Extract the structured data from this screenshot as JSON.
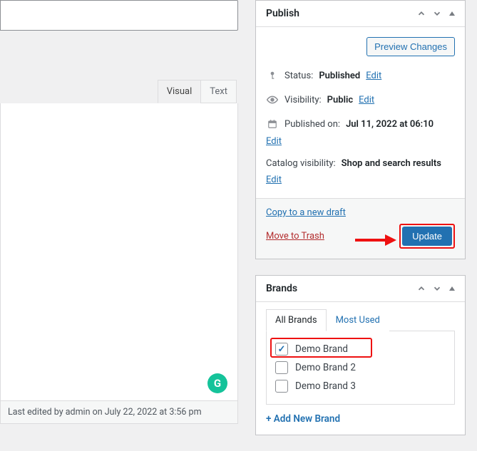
{
  "editor": {
    "tabs": {
      "visual": "Visual",
      "text": "Text"
    },
    "status_bar": "Last edited by admin on July 22, 2022 at 3:56 pm",
    "grammarly_glyph": "G"
  },
  "publish": {
    "title": "Publish",
    "preview_button": "Preview Changes",
    "status_label": "Status:",
    "status_value": "Published",
    "status_edit": "Edit",
    "visibility_label": "Visibility:",
    "visibility_value": "Public",
    "visibility_edit": "Edit",
    "published_label": "Published on:",
    "published_value": "Jul 11, 2022 at 06:10",
    "published_edit": "Edit",
    "catalog_label": "Catalog visibility:",
    "catalog_value": "Shop and search results",
    "catalog_edit": "Edit",
    "copy_link": "Copy to a new draft",
    "trash_link": "Move to Trash",
    "update_button": "Update"
  },
  "brands": {
    "title": "Brands",
    "tab_all": "All Brands",
    "tab_most": "Most Used",
    "items": [
      {
        "label": "Demo Brand",
        "checked": true,
        "highlight": true
      },
      {
        "label": "Demo Brand 2",
        "checked": false,
        "highlight": false
      },
      {
        "label": "Demo Brand 3",
        "checked": false,
        "highlight": false
      }
    ],
    "add_new": "+ Add New Brand"
  }
}
